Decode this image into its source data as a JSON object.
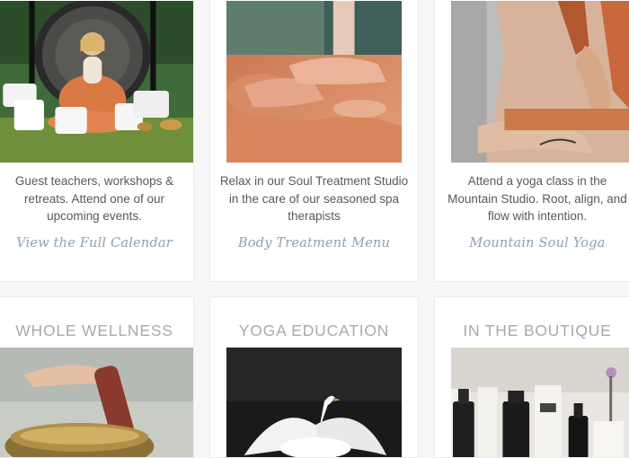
{
  "cards_top": [
    {
      "description": "Guest teachers, workshops & retreats. Attend one of our upcoming events.",
      "link": "View the Full Calendar",
      "image": "gong-meditation-photo"
    },
    {
      "description": "Relax in our Soul Treatment Studio in the care of our seasoned spa therapists",
      "link": "Body Treatment Menu",
      "image": "massage-photo"
    },
    {
      "description": "Attend a yoga class in the Mountain Studio. Root, align, and flow with intention.",
      "link": "Mountain Soul Yoga",
      "image": "yoga-back-prayer-photo"
    }
  ],
  "cards_bottom": [
    {
      "title": "WHOLE WELLNESS",
      "image": "singing-bowl-photo"
    },
    {
      "title": "YOGA EDUCATION",
      "image": "swan-photo"
    },
    {
      "title": "IN THE BOUTIQUE",
      "image": "skincare-products-photo"
    }
  ],
  "colors": {
    "link": "#8ea1b5",
    "title": "#aaaaaa",
    "text": "#595959",
    "card_border": "#ececec",
    "page_bg": "#f7f7f7"
  }
}
